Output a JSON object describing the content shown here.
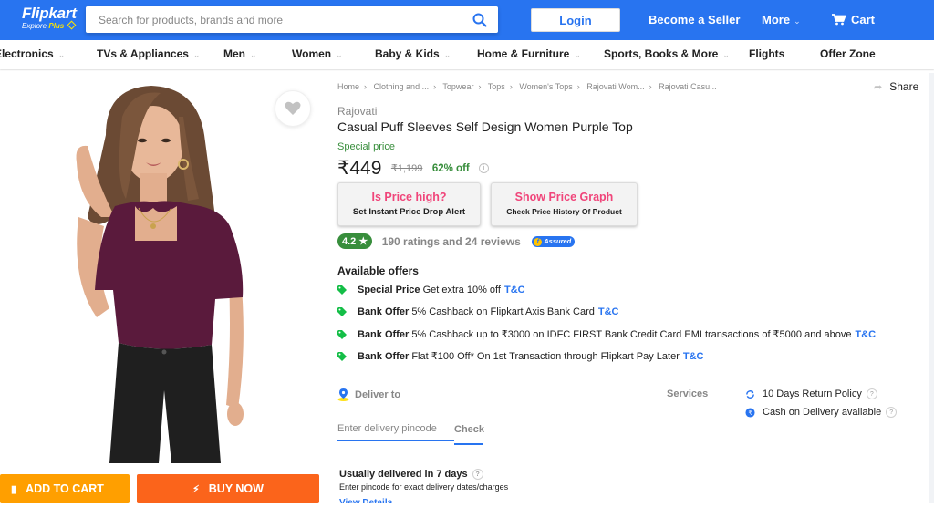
{
  "header": {
    "logo": "Flipkart",
    "logo_sub_1": "Explore",
    "logo_sub_2": "Plus",
    "search_placeholder": "Search for products, brands and more",
    "login": "Login",
    "become_seller": "Become a Seller",
    "more": "More",
    "cart": "Cart"
  },
  "categories": [
    {
      "label": "Electronics",
      "has_menu": true
    },
    {
      "label": "TVs & Appliances",
      "has_menu": true
    },
    {
      "label": "Men",
      "has_menu": true
    },
    {
      "label": "Women",
      "has_menu": true
    },
    {
      "label": "Baby & Kids",
      "has_menu": true
    },
    {
      "label": "Home & Furniture",
      "has_menu": true
    },
    {
      "label": "Sports, Books & More",
      "has_menu": true
    },
    {
      "label": "Flights",
      "has_menu": false
    },
    {
      "label": "Offer Zone",
      "has_menu": false
    }
  ],
  "product": {
    "breadcrumb": [
      "Home",
      "Clothing and ...",
      "Topwear",
      "Tops",
      "Women's Tops",
      "Rajovati Wom...",
      "Rajovati Casu..."
    ],
    "share": "Share",
    "brand": "Rajovati",
    "title": "Casual Puff Sleeves Self Design Women Purple Top",
    "special_price_label": "Special price",
    "price": "₹449",
    "mrp": "₹1,199",
    "discount": "62% off",
    "price_alert": {
      "line1": "Is Price high?",
      "line2": "Set Instant Price Drop Alert"
    },
    "price_graph": {
      "line1": "Show Price Graph",
      "line2": "Check Price History Of Product"
    },
    "rating": "4.2",
    "rating_star": "★",
    "ratings_text": "190 ratings and 24 reviews",
    "assured_label": "Assured"
  },
  "offers": {
    "title": "Available offers",
    "items": [
      {
        "type": "Special Price",
        "text": "Get extra 10% off",
        "link": "T&C"
      },
      {
        "type": "Bank Offer",
        "text": "5% Cashback on Flipkart Axis Bank Card",
        "link": "T&C"
      },
      {
        "type": "Bank Offer",
        "text": "5% Cashback up to ₹3000 on IDFC FIRST Bank Credit Card EMI transactions of ₹5000 and above",
        "link": "T&C"
      },
      {
        "type": "Bank Offer",
        "text": "Flat ₹100 Off* On 1st Transaction through Flipkart Pay Later",
        "link": "T&C"
      }
    ]
  },
  "delivery": {
    "label": "Deliver to",
    "pincode_placeholder": "Enter delivery pincode",
    "check": "Check",
    "usually": "Usually delivered in 7 days",
    "usually_sub": "Enter pincode for exact delivery dates/charges",
    "view_details": "View Details"
  },
  "services": {
    "label": "Services",
    "items": [
      "10 Days Return Policy",
      "Cash on Delivery available"
    ]
  },
  "actions": {
    "add_to_cart": "ADD TO CART",
    "buy_now": "BUY NOW"
  },
  "colors": {
    "brand_blue": "#2874f0",
    "add_to_cart": "#ff9f00",
    "buy_now": "#fb641b",
    "rating_green": "#388e3c",
    "price_box_pink": "#f0457a",
    "product_purple": "#5a1a3c"
  }
}
